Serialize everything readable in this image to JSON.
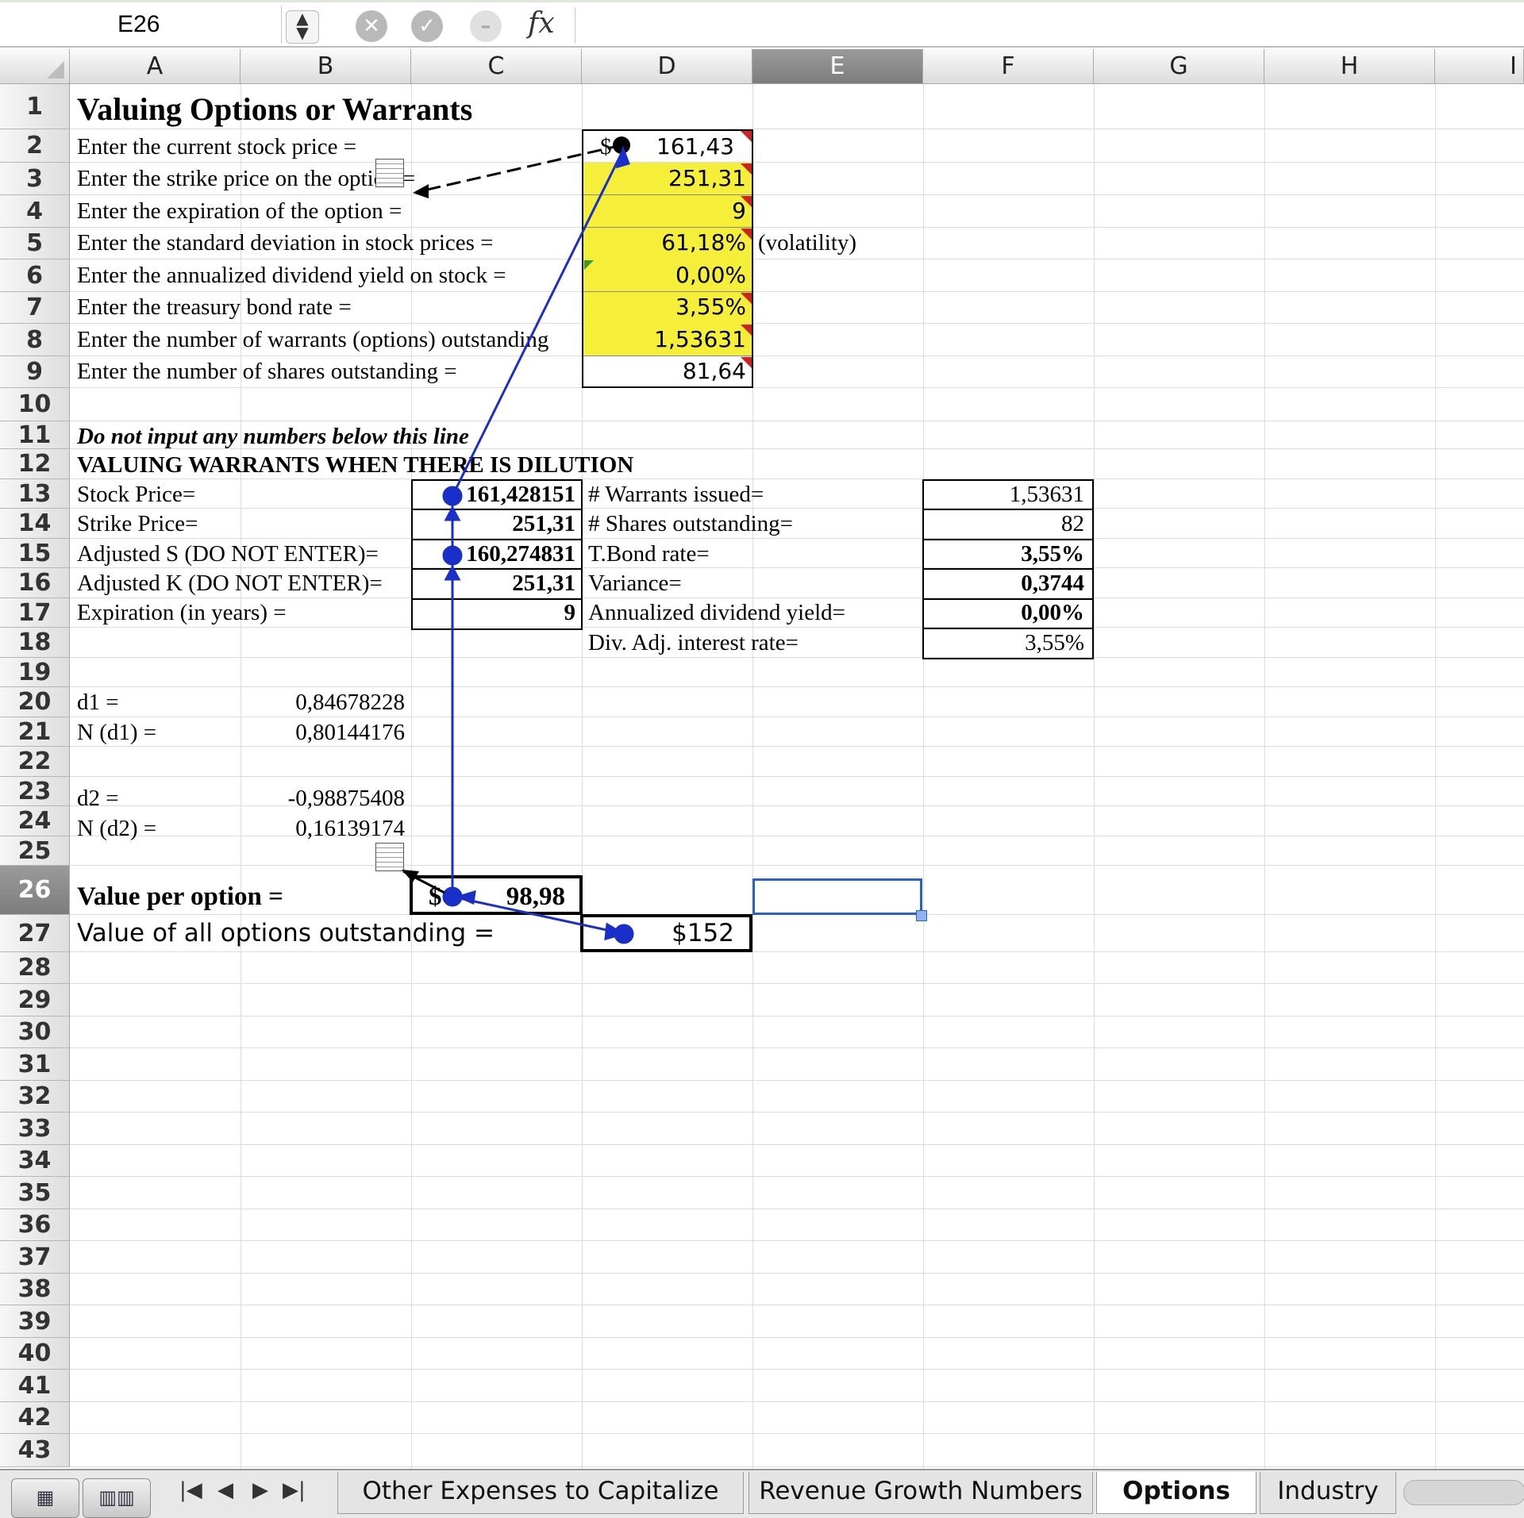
{
  "formula_bar": {
    "name_box": "E26",
    "fx_label": "fx",
    "formula": ""
  },
  "columns": [
    "A",
    "B",
    "C",
    "D",
    "E",
    "F",
    "G",
    "H",
    "I"
  ],
  "selected_column": "E",
  "selected_row": 26,
  "rows": [
    "1",
    "2",
    "3",
    "4",
    "5",
    "6",
    "7",
    "8",
    "9",
    "10",
    "11",
    "12",
    "13",
    "14",
    "15",
    "16",
    "17",
    "18",
    "19",
    "20",
    "21",
    "22",
    "23",
    "24",
    "25",
    "26",
    "27",
    "28",
    "29",
    "30",
    "31",
    "32",
    "33",
    "34",
    "35",
    "36",
    "37",
    "38",
    "39",
    "40",
    "41",
    "42",
    "43"
  ],
  "sheet": {
    "title": "Valuing Options or Warrants",
    "inputs": [
      {
        "label": "Enter the current stock price =",
        "prefix": "$",
        "value": "161,43"
      },
      {
        "label": "Enter the strike price on the option =",
        "value": "251,31"
      },
      {
        "label": "Enter the expiration of the option =",
        "value": "9"
      },
      {
        "label": "Enter the standard deviation in stock prices =",
        "value": "61,18%",
        "note": "(volatility)"
      },
      {
        "label": "Enter the annualized dividend yield on stock =",
        "value": "0,00%"
      },
      {
        "label": "Enter the treasury bond rate =",
        "value": "3,55%"
      },
      {
        "label": "Enter the number of warrants (options) outstanding",
        "value": "1,53631"
      },
      {
        "label": "Enter the number of shares outstanding =",
        "value": "81,64"
      }
    ],
    "warning": "Do not input any numbers below this line",
    "section_title": "VALUING WARRANTS WHEN THERE IS DILUTION",
    "left_table": [
      {
        "label": "Stock Price=",
        "value": "161,428151"
      },
      {
        "label": "Strike Price=",
        "value": "251,31"
      },
      {
        "label": "Adjusted S (DO NOT ENTER)=",
        "value": "160,274831"
      },
      {
        "label": "Adjusted K (DO NOT ENTER)=",
        "value": "251,31"
      },
      {
        "label": "Expiration (in years) =",
        "value": "9"
      }
    ],
    "right_table": [
      {
        "label": "# Warrants issued=",
        "value": "1,53631"
      },
      {
        "label": "# Shares outstanding=",
        "value": "82"
      },
      {
        "label": "T.Bond rate=",
        "value": "3,55%"
      },
      {
        "label": "Variance=",
        "value": "0,3744"
      },
      {
        "label": "Annualized dividend yield=",
        "value": "0,00%"
      },
      {
        "label": "Div. Adj. interest rate=",
        "value": "3,55%"
      }
    ],
    "d_values": [
      {
        "label": "d1 =",
        "value": "0,84678228"
      },
      {
        "label": "N (d1) =",
        "value": "0,80144176"
      },
      {
        "label": "d2 =",
        "value": "-0,98875408"
      },
      {
        "label": "N (d2) =",
        "value": "0,16139174"
      }
    ],
    "value_per_option": {
      "label": "Value per option =",
      "prefix": "$",
      "value": "98,98"
    },
    "value_all": {
      "label": "Value of all options outstanding =",
      "value": "$152"
    }
  },
  "tabs": {
    "items": [
      "Other Expenses to Capitalize",
      "Revenue Growth Numbers",
      "Options",
      "Industry"
    ],
    "active": "Options"
  },
  "colors": {
    "input_fill": "#f5ef3a",
    "trace_arrow": "#1a2fc8",
    "selection": "#2a5fd0"
  }
}
